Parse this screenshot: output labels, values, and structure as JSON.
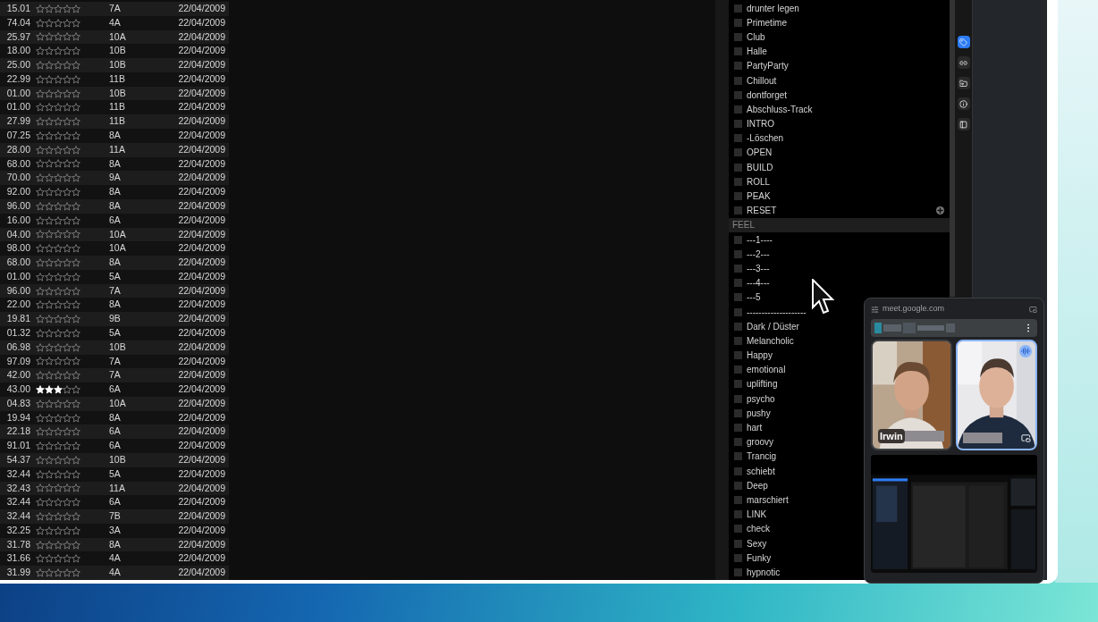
{
  "tracks": [
    {
      "bpm": "15.01",
      "stars": 0,
      "key": "7A",
      "date": "22/04/2009"
    },
    {
      "bpm": "74.04",
      "stars": 0,
      "key": "4A",
      "date": "22/04/2009"
    },
    {
      "bpm": "25.97",
      "stars": 0,
      "key": "10A",
      "date": "22/04/2009"
    },
    {
      "bpm": "18.00",
      "stars": 0,
      "key": "10B",
      "date": "22/04/2009"
    },
    {
      "bpm": "25.00",
      "stars": 0,
      "key": "10B",
      "date": "22/04/2009"
    },
    {
      "bpm": "22.99",
      "stars": 0,
      "key": "11B",
      "date": "22/04/2009"
    },
    {
      "bpm": "01.00",
      "stars": 0,
      "key": "10B",
      "date": "22/04/2009"
    },
    {
      "bpm": "01.00",
      "stars": 0,
      "key": "11B",
      "date": "22/04/2009"
    },
    {
      "bpm": "27.99",
      "stars": 0,
      "key": "11B",
      "date": "22/04/2009"
    },
    {
      "bpm": "07.25",
      "stars": 0,
      "key": "8A",
      "date": "22/04/2009"
    },
    {
      "bpm": "28.00",
      "stars": 0,
      "key": "11A",
      "date": "22/04/2009"
    },
    {
      "bpm": "68.00",
      "stars": 0,
      "key": "8A",
      "date": "22/04/2009"
    },
    {
      "bpm": "70.00",
      "stars": 0,
      "key": "9A",
      "date": "22/04/2009"
    },
    {
      "bpm": "92.00",
      "stars": 0,
      "key": "8A",
      "date": "22/04/2009"
    },
    {
      "bpm": "96.00",
      "stars": 0,
      "key": "8A",
      "date": "22/04/2009"
    },
    {
      "bpm": "16.00",
      "stars": 0,
      "key": "6A",
      "date": "22/04/2009"
    },
    {
      "bpm": "04.00",
      "stars": 0,
      "key": "10A",
      "date": "22/04/2009"
    },
    {
      "bpm": "98.00",
      "stars": 0,
      "key": "10A",
      "date": "22/04/2009"
    },
    {
      "bpm": "68.00",
      "stars": 0,
      "key": "8A",
      "date": "22/04/2009"
    },
    {
      "bpm": "01.00",
      "stars": 0,
      "key": "5A",
      "date": "22/04/2009"
    },
    {
      "bpm": "96.00",
      "stars": 0,
      "key": "7A",
      "date": "22/04/2009"
    },
    {
      "bpm": "22.00",
      "stars": 0,
      "key": "8A",
      "date": "22/04/2009"
    },
    {
      "bpm": "19.81",
      "stars": 0,
      "key": "9B",
      "date": "22/04/2009"
    },
    {
      "bpm": "01.32",
      "stars": 0,
      "key": "5A",
      "date": "22/04/2009"
    },
    {
      "bpm": "06.98",
      "stars": 0,
      "key": "10B",
      "date": "22/04/2009"
    },
    {
      "bpm": "97.09",
      "stars": 0,
      "key": "7A",
      "date": "22/04/2009"
    },
    {
      "bpm": "42.00",
      "stars": 0,
      "key": "7A",
      "date": "22/04/2009"
    },
    {
      "bpm": "43.00",
      "stars": 3,
      "key": "6A",
      "date": "22/04/2009"
    },
    {
      "bpm": "04.83",
      "stars": 0,
      "key": "10A",
      "date": "22/04/2009"
    },
    {
      "bpm": "19.94",
      "stars": 0,
      "key": "8A",
      "date": "22/04/2009"
    },
    {
      "bpm": "22.18",
      "stars": 0,
      "key": "6A",
      "date": "22/04/2009"
    },
    {
      "bpm": "91.01",
      "stars": 0,
      "key": "6A",
      "date": "22/04/2009"
    },
    {
      "bpm": "54.37",
      "stars": 0,
      "key": "10B",
      "date": "22/04/2009"
    },
    {
      "bpm": "32.44",
      "stars": 0,
      "key": "5A",
      "date": "22/04/2009"
    },
    {
      "bpm": "32.43",
      "stars": 0,
      "key": "11A",
      "date": "22/04/2009"
    },
    {
      "bpm": "32.44",
      "stars": 0,
      "key": "6A",
      "date": "22/04/2009"
    },
    {
      "bpm": "32.44",
      "stars": 0,
      "key": "7B",
      "date": "22/04/2009"
    },
    {
      "bpm": "32.25",
      "stars": 0,
      "key": "3A",
      "date": "22/04/2009"
    },
    {
      "bpm": "31.78",
      "stars": 0,
      "key": "8A",
      "date": "22/04/2009"
    },
    {
      "bpm": "31.66",
      "stars": 0,
      "key": "4A",
      "date": "22/04/2009"
    },
    {
      "bpm": "31.99",
      "stars": 0,
      "key": "4A",
      "date": "22/04/2009"
    }
  ],
  "tags": [
    {
      "kind": "item",
      "label": "drunter legen",
      "checked": false
    },
    {
      "kind": "item",
      "label": "Primetime",
      "checked": false
    },
    {
      "kind": "item",
      "label": "Club",
      "checked": false
    },
    {
      "kind": "item",
      "label": "Halle",
      "checked": false
    },
    {
      "kind": "item",
      "label": "PartyParty",
      "checked": false
    },
    {
      "kind": "item",
      "label": "Chillout",
      "checked": false
    },
    {
      "kind": "item",
      "label": "dontforget",
      "checked": false
    },
    {
      "kind": "item",
      "label": "Abschluss-Track",
      "checked": false
    },
    {
      "kind": "item",
      "label": "INTRO",
      "checked": false
    },
    {
      "kind": "item",
      "label": "-Löschen",
      "checked": false
    },
    {
      "kind": "item",
      "label": "OPEN",
      "checked": false
    },
    {
      "kind": "item",
      "label": "BUILD",
      "checked": false
    },
    {
      "kind": "item",
      "label": "ROLL",
      "checked": false
    },
    {
      "kind": "item",
      "label": "PEAK",
      "checked": false
    },
    {
      "kind": "item",
      "label": "RESET",
      "checked": false,
      "add_button": true
    },
    {
      "kind": "header",
      "label": "FEEL"
    },
    {
      "kind": "item",
      "label": "---1----",
      "checked": false
    },
    {
      "kind": "item",
      "label": "---2---",
      "checked": false
    },
    {
      "kind": "item",
      "label": "---3---",
      "checked": false
    },
    {
      "kind": "item",
      "label": "---4---",
      "checked": false
    },
    {
      "kind": "item",
      "label": "---5",
      "checked": false
    },
    {
      "kind": "item",
      "label": "--------------------",
      "checked": false
    },
    {
      "kind": "item",
      "label": "Dark / Düster",
      "checked": false
    },
    {
      "kind": "item",
      "label": "Melancholic",
      "checked": false
    },
    {
      "kind": "item",
      "label": "Happy",
      "checked": false
    },
    {
      "kind": "item",
      "label": "emotional",
      "checked": false
    },
    {
      "kind": "item",
      "label": "uplifting",
      "checked": false
    },
    {
      "kind": "item",
      "label": "psycho",
      "checked": false
    },
    {
      "kind": "item",
      "label": "pushy",
      "checked": false
    },
    {
      "kind": "item",
      "label": "hart",
      "checked": false
    },
    {
      "kind": "item",
      "label": "groovy",
      "checked": false
    },
    {
      "kind": "item",
      "label": "Trancig",
      "checked": false
    },
    {
      "kind": "item",
      "label": "schiebt",
      "checked": false
    },
    {
      "kind": "item",
      "label": "Deep",
      "checked": false
    },
    {
      "kind": "item",
      "label": "marschiert",
      "checked": false
    },
    {
      "kind": "item",
      "label": "LINK",
      "checked": false
    },
    {
      "kind": "item",
      "label": "check",
      "checked": false
    },
    {
      "kind": "item",
      "label": "Sexy",
      "checked": false
    },
    {
      "kind": "item",
      "label": "Funky",
      "checked": false
    },
    {
      "kind": "item",
      "label": "hypnotic",
      "checked": false
    }
  ],
  "side_tools": [
    {
      "kind": "tag",
      "selected": true
    },
    {
      "kind": "link",
      "selected": false
    },
    {
      "kind": "folder",
      "selected": false
    },
    {
      "kind": "info",
      "selected": false
    },
    {
      "kind": "panel",
      "selected": false
    }
  ],
  "meet": {
    "url": "meet.google.com",
    "participants": [
      {
        "name": "Irwin",
        "speaking": false
      },
      {
        "speaking": true
      }
    ]
  }
}
